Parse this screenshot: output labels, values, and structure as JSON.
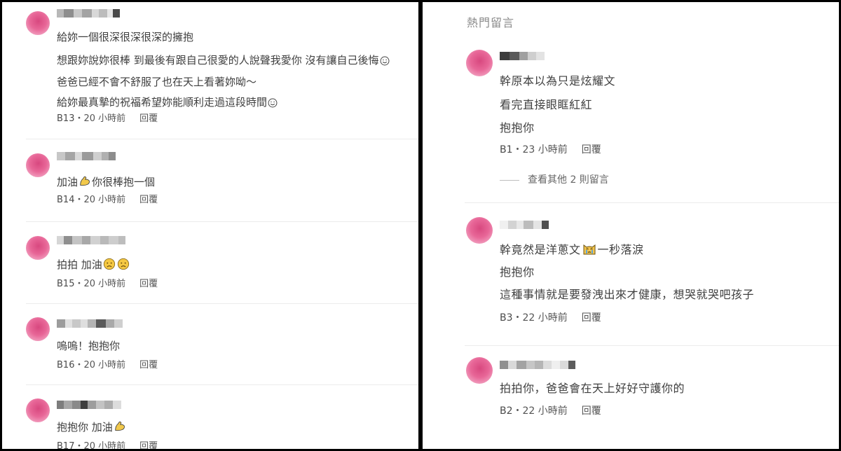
{
  "reply_label": "回覆",
  "left_comments": [
    {
      "lines": [
        "給妳一個很深很深很深的擁抱",
        "想跟妳說妳很棒 到最後有跟自己很愛的人說聲我愛你 沒有讓自己後悔",
        "爸爸已經不會不舒服了也在天上看著妳呦～",
        "給妳最真摯的祝福希望妳能順利走過這段時間"
      ],
      "floor": "B13",
      "time": "・20 小時前"
    },
    {
      "lines": [
        "加油",
        "你很棒抱一個"
      ],
      "floor": "B14",
      "time": "・20 小時前"
    },
    {
      "lines": [
        "拍拍 加油"
      ],
      "floor": "B15",
      "time": "・20 小時前"
    },
    {
      "lines": [
        "嗚嗚！抱抱你"
      ],
      "floor": "B16",
      "time": "・20 小時前"
    },
    {
      "lines": [
        "抱抱你 加油"
      ],
      "floor": "B17",
      "time": "・20 小時前"
    }
  ],
  "right_panel": {
    "section_title": "熱門留言",
    "comments": [
      {
        "lines": [
          "幹原本以為只是炫耀文",
          "看完直接眼眶紅紅",
          "抱抱你"
        ],
        "floor": "B1",
        "time": "・23 小時前"
      },
      {
        "lines": [
          "幹竟然是洋蔥文",
          "一秒落淚",
          "抱抱你",
          "這種事情就是要發洩出來才健康，想哭就哭吧孩子"
        ],
        "floor": "B3",
        "time": "・22 小時前"
      },
      {
        "lines": [
          "拍拍你，爸爸會在天上好好守護你的"
        ],
        "floor": "B2",
        "time": "・22 小時前"
      }
    ],
    "more_replies": "查看其他 2 則留言"
  },
  "icons": [
    "smile-emoji-icon",
    "flexed-biceps-emoji-icon",
    "sad-face-emoji-icon",
    "crying-cat-emoji-icon"
  ],
  "colors": {
    "avatar": "#e86798",
    "text": "#3f3f3f",
    "meta": "#555555",
    "divider": "#ececec",
    "frame": "#000000"
  }
}
